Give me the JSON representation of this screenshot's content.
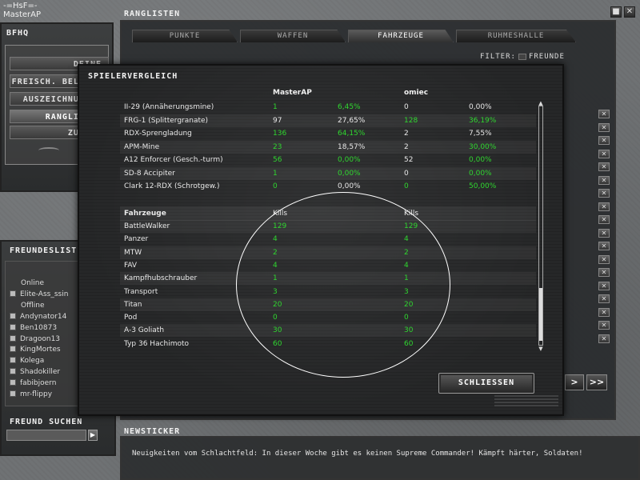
{
  "player": {
    "clan": "-=HsF=-",
    "name": "MasterAP"
  },
  "ranglisten": {
    "title": "RANGLISTEN",
    "tabs": [
      "PUNKTE",
      "WAFFEN",
      "FAHRZEUGE",
      "RUHMESHALLE"
    ],
    "active_tab": "FAHRZEUGE",
    "filter_label": "FILTER:",
    "filter_option": "FREUNDE",
    "nav_next": ">",
    "nav_last": ">>"
  },
  "window_buttons": {
    "minimize": "■",
    "close": "✕"
  },
  "bfhq": {
    "title": "BFHQ",
    "menu": [
      "DEINE STATISTIKEN",
      "FREISCH. BELOHN.",
      "AUSZEICHNUNGEN",
      "RANGLISTEN",
      "ZURÜCK"
    ],
    "active_menu": "RANGLISTEN"
  },
  "friends": {
    "title": "FREUNDESLISTE",
    "online_label": "Online",
    "offline_label": "Offline",
    "online": [
      "Elite-Ass_ssin"
    ],
    "offline": [
      "Andynator14",
      "Ben10873",
      "Dragoon13",
      "KingMortes",
      "Kolega",
      "Shadokiller",
      "fabibjoern",
      "mr-flippy"
    ],
    "search_label": "FREUND SUCHEN",
    "search_value": "",
    "search_button": "▶"
  },
  "newsticker": {
    "title": "NEWSTICKER",
    "text": "Neuigkeiten vom Schlachtfeld: In dieser Woche gibt es keinen Supreme Commander! Kämpft härter, Soldaten!"
  },
  "dialog": {
    "title": "SPIELERVERGLEICH",
    "player1": "MasterAP",
    "player2": "omiec",
    "weapons": [
      {
        "name": "II-29 (Annäherungsmine)",
        "v1": "1",
        "p1": "6,45%",
        "v2": "0",
        "p2": "0,00%",
        "c1": "green",
        "c2": "white"
      },
      {
        "name": "FRG-1 (Splittergranate)",
        "v1": "97",
        "p1": "27,65%",
        "v2": "128",
        "p2": "36,19%",
        "c1": "white",
        "c2": "green"
      },
      {
        "name": "RDX-Sprengladung",
        "v1": "136",
        "p1": "64,15%",
        "v2": "2",
        "p2": "7,55%",
        "c1": "green",
        "c2": "white"
      },
      {
        "name": "APM-Mine",
        "v1": "23",
        "p1": "18,57%",
        "v2": "2",
        "p2": "30,00%",
        "c1": "green",
        "c2": "mixed"
      },
      {
        "name": "A12 Enforcer (Gesch.-turm)",
        "v1": "56",
        "p1": "0,00%",
        "v2": "52",
        "p2": "0,00%",
        "c1": "green",
        "c2": "mixedp"
      },
      {
        "name": "SD-8 Accipiter",
        "v1": "1",
        "p1": "0,00%",
        "v2": "0",
        "p2": "0,00%",
        "c1": "green",
        "c2": "mixedp"
      },
      {
        "name": "Clark 12-RDX (Schrotgew.)",
        "v1": "0",
        "p1": "0,00%",
        "v2": "0",
        "p2": "50,00%",
        "c1": "greenv",
        "c2": "green"
      }
    ],
    "vehicles_header": "Fahrzeuge",
    "kills_label": "Kills",
    "vehicles": [
      {
        "name": "BattleWalker",
        "v1": "129",
        "v2": "129"
      },
      {
        "name": "Panzer",
        "v1": "4",
        "v2": "4"
      },
      {
        "name": "MTW",
        "v1": "2",
        "v2": "2"
      },
      {
        "name": "FAV",
        "v1": "4",
        "v2": "4"
      },
      {
        "name": "Kampfhubschrauber",
        "v1": "1",
        "v2": "1"
      },
      {
        "name": "Transport",
        "v1": "3",
        "v2": "3"
      },
      {
        "name": "Titan",
        "v1": "20",
        "v2": "20"
      },
      {
        "name": "Pod",
        "v1": "0",
        "v2": "0"
      },
      {
        "name": "A-3 Goliath",
        "v1": "30",
        "v2": "30"
      },
      {
        "name": "Typ 36 Hachimoto",
        "v1": "60",
        "v2": "60"
      }
    ],
    "close_button": "SCHLIESSEN"
  },
  "colors": {
    "highlight_green": "#2fd62f",
    "text": "#e8e8e8"
  }
}
